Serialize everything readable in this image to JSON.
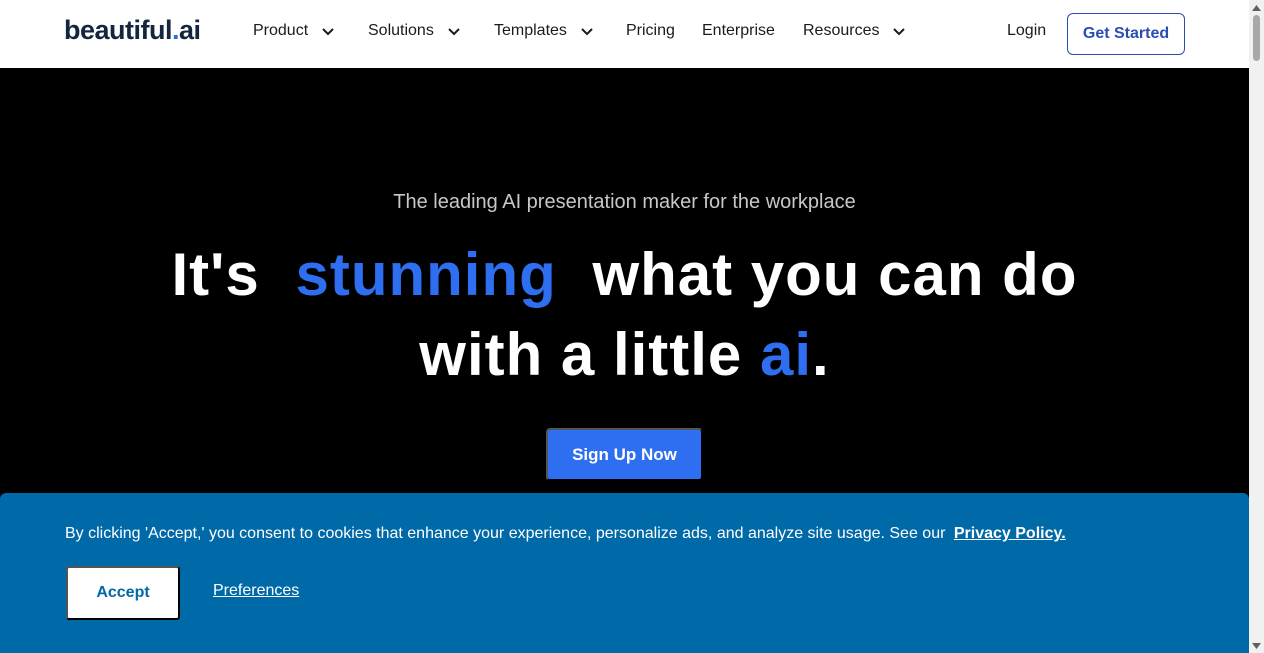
{
  "header": {
    "logo_main": "beautiful",
    "logo_dot": ".",
    "logo_ai": "ai",
    "nav": [
      {
        "label": "Product",
        "has_dropdown": true
      },
      {
        "label": "Solutions",
        "has_dropdown": true
      },
      {
        "label": "Templates",
        "has_dropdown": true
      },
      {
        "label": "Pricing",
        "has_dropdown": false
      },
      {
        "label": "Enterprise",
        "has_dropdown": false
      },
      {
        "label": "Resources",
        "has_dropdown": true
      }
    ],
    "login_label": "Login",
    "cta_label": "Get Started"
  },
  "hero": {
    "tagline": "The leading AI presentation maker for the workplace",
    "line1_a": "It's",
    "line1_highlight": "stunning",
    "line1_b": "what you can do",
    "line2_a": "with a little",
    "line2_highlight": "ai",
    "line2_b": ".",
    "signup_label": "Sign Up Now"
  },
  "cookie_banner": {
    "text": "By clicking 'Accept,' you consent to cookies that enhance your experience, personalize ads, and analyze site usage. See our",
    "privacy_label": "Privacy Policy.",
    "accept_label": "Accept",
    "preferences_label": "Preferences"
  },
  "colors": {
    "brand_blue": "#2e6ef0",
    "logo_navy": "#13253f",
    "banner_blue": "#0069a8",
    "hero_bg": "#000000"
  }
}
